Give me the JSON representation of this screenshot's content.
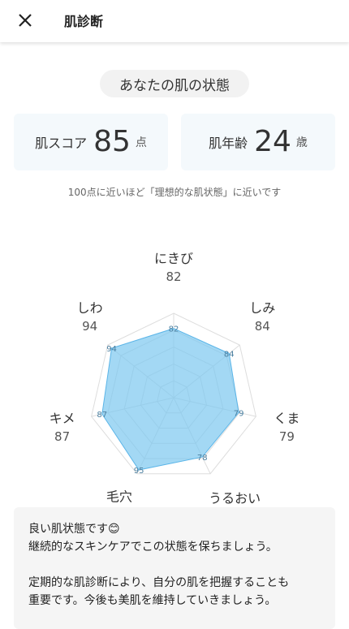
{
  "header": {
    "title": "肌診断",
    "close_icon": "close-icon"
  },
  "status_label": "あなたの肌の状態",
  "skin_score": {
    "label": "肌スコア",
    "value": "85",
    "unit": "点"
  },
  "skin_age": {
    "label": "肌年齢",
    "value": "24",
    "unit": "歳"
  },
  "hint": "100点に近いほど「理想的な肌状態」に近いです",
  "chart_data": {
    "type": "radar",
    "categories": [
      "にきび",
      "しみ",
      "くま",
      "うるおい",
      "毛穴",
      "キメ",
      "しわ"
    ],
    "values": [
      82,
      84,
      79,
      78,
      95,
      87,
      94
    ],
    "value_labels": [
      "82",
      "84",
      "79",
      "78",
      "95",
      "87",
      "94"
    ],
    "range": [
      0,
      100
    ],
    "rings": 5,
    "colors": {
      "fill": "#7cc8f0",
      "stroke": "#5bb5e8",
      "grid": "#dddddd"
    }
  },
  "message": {
    "line1": "良い肌状態です😊",
    "line2": "継続的なスキンケアでこの状態を保ちましょう。",
    "line3": "定期的な肌診断により、自分の肌を把握することも",
    "line4": "重要です。今後も美肌を維持していきましょう。"
  }
}
